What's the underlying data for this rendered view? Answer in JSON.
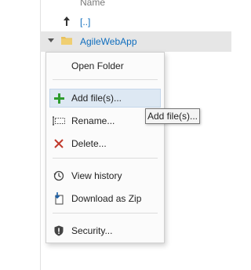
{
  "list": {
    "column_header": "Name",
    "parent_link": "[..]",
    "selected_folder": "AgileWebApp"
  },
  "context_menu": {
    "items": [
      {
        "label": "Open Folder",
        "icon": "none"
      },
      {
        "label": "Add file(s)...",
        "icon": "plus-icon"
      },
      {
        "label": "Rename...",
        "icon": "rename-icon"
      },
      {
        "label": "Delete...",
        "icon": "delete-x-icon"
      },
      {
        "label": "View history",
        "icon": "history-icon"
      },
      {
        "label": "Download as Zip",
        "icon": "download-zip-icon"
      },
      {
        "label": "Security...",
        "icon": "shield-icon"
      }
    ],
    "hovered_index": 1
  },
  "tooltip": {
    "text": "Add file(s)..."
  },
  "colors": {
    "link": "#106ebe",
    "selected_row": "#e6e6e6",
    "hover_item": "#dde8f3",
    "plus_green": "#2e9c2e",
    "delete_red": "#c0392b",
    "folder_yellow": "#e8c05c"
  }
}
